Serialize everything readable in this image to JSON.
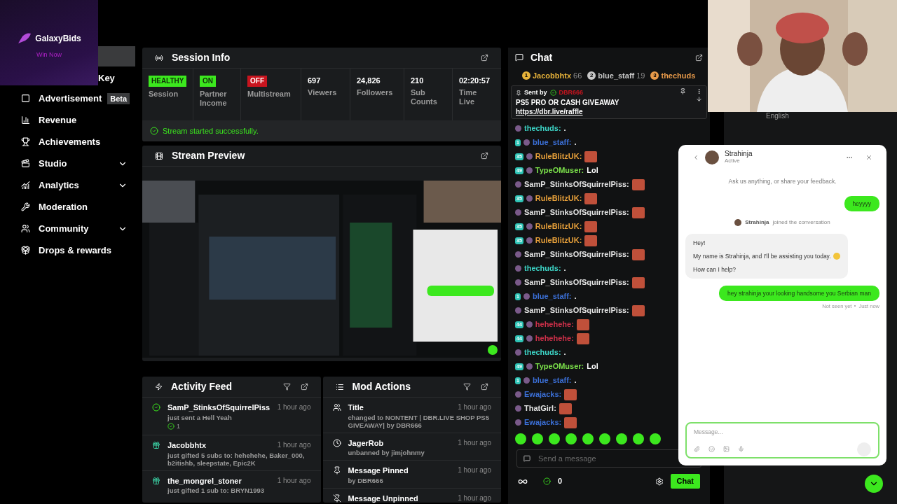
{
  "ad": {
    "brand": "GalaxyBids",
    "tagline": "Win Now"
  },
  "sidebar": {
    "items": [
      {
        "label": "Key",
        "kind": "partial"
      },
      {
        "label": "Advertisement",
        "badge": "Beta",
        "kind": "item",
        "expandable": false
      },
      {
        "label": "Revenue",
        "kind": "item",
        "expandable": false
      },
      {
        "label": "Achievements",
        "kind": "item",
        "expandable": false
      },
      {
        "label": "Studio",
        "kind": "item",
        "expandable": true
      },
      {
        "label": "Analytics",
        "kind": "item",
        "expandable": true
      },
      {
        "label": "Moderation",
        "kind": "item",
        "expandable": false
      },
      {
        "label": "Community",
        "kind": "item",
        "expandable": true
      },
      {
        "label": "Drops & rewards",
        "kind": "item",
        "expandable": false
      }
    ]
  },
  "session_info": {
    "title": "Session Info",
    "stats": [
      {
        "kind": "badge",
        "value": "HEALTHY",
        "label": "Session",
        "color": "#3ce81e"
      },
      {
        "kind": "badge",
        "value": "ON",
        "label": "Partner Income",
        "color": "#3ce81e"
      },
      {
        "kind": "badge",
        "value": "OFF",
        "label": "Multistream",
        "color": "#c8141e"
      },
      {
        "kind": "stat",
        "value": "697",
        "label": "Viewers"
      },
      {
        "kind": "stat",
        "value": "24,826",
        "label": "Followers"
      },
      {
        "kind": "stat",
        "value": "210",
        "label": "Sub Counts"
      },
      {
        "kind": "stat",
        "value": "02:20:57",
        "label": "Time Live"
      }
    ],
    "notice": "Stream started successfully."
  },
  "stream_preview": {
    "title": "Stream Preview",
    "kind": "picture"
  },
  "activity_feed": {
    "title": "Activity Feed",
    "items": [
      {
        "kind": "kick",
        "user": "SamP_StinksOfSquirrelPiss",
        "time": "1 hour ago",
        "detail": "just sent a **Hell Yeah**",
        "amount": "1"
      },
      {
        "kind": "gift",
        "user": "Jacobbhtx",
        "time": "1 hour ago",
        "detail": "just gifted **5** subs to: **hehehehe, Baker_000, b2itishb, sleepstate, Epic2K**"
      },
      {
        "kind": "gift",
        "user": "the_mongrel_stoner",
        "time": "1 hour ago",
        "detail": "just gifted **1** sub to: **BRYN1993**"
      }
    ]
  },
  "mod_actions": {
    "title": "Mod Actions",
    "items": [
      {
        "kind": "title",
        "title": "Title",
        "time": "1 hour ago",
        "detail": "changed to **NONTENT | DBR.LIVE SHOP PS5 GIVEAWAY|** by **DBR666**"
      },
      {
        "kind": "unban",
        "title": "JagerRob",
        "time": "1 hour ago",
        "detail": "unbanned by **jimjohnmy**"
      },
      {
        "kind": "pin",
        "title": "Message Pinned",
        "time": "1 hour ago",
        "detail": "by **DBR666**"
      },
      {
        "kind": "unpin",
        "title": "Message Unpinned",
        "time": "1 hour ago"
      }
    ]
  },
  "chat": {
    "title": "Chat",
    "leaderboard": [
      {
        "rank": "1",
        "user": "Jacobbhtx",
        "count": "66",
        "color": "#e8b33a"
      },
      {
        "rank": "2",
        "user": "blue_staff",
        "count": "19",
        "color": "#c8c8c8"
      },
      {
        "rank": "3",
        "user": "thechuds",
        "color": "#e89a4a"
      }
    ],
    "pinned": {
      "label": "Sent by",
      "sender": "DBR666",
      "text": "PS5 PRO OR CASH GIVEAWAY",
      "link": "https://dbr.live/raffle"
    },
    "messages": [
      {
        "user": "thechuds:",
        "text": ".",
        "color": "#3dd6c8",
        "emote": false
      },
      {
        "user": "blue_staff:",
        "text": ".",
        "color": "#3b6fd6",
        "badge": "1",
        "emote": false
      },
      {
        "user": "RuleBlitzUK:",
        "color": "#e8a03a",
        "badge": "35",
        "emote": true
      },
      {
        "user": "TypeOMuser:",
        "text": "Lol",
        "color": "#7be04a",
        "badge": "49",
        "emote": false
      },
      {
        "user": "SamP_StinksOfSquirrelPiss:",
        "color": "#e5e5e5",
        "emote": true
      },
      {
        "user": "RuleBlitzUK:",
        "color": "#e8a03a",
        "badge": "35",
        "emote": true
      },
      {
        "user": "SamP_StinksOfSquirrelPiss:",
        "color": "#e5e5e5",
        "emote": true
      },
      {
        "user": "RuleBlitzUK:",
        "color": "#e8a03a",
        "badge": "35",
        "emote": true
      },
      {
        "user": "RuleBlitzUK:",
        "color": "#e8a03a",
        "badge": "35",
        "emote": true
      },
      {
        "user": "SamP_StinksOfSquirrelPiss:",
        "color": "#e5e5e5",
        "emote": true
      },
      {
        "user": "thechuds:",
        "text": ".",
        "color": "#3dd6c8",
        "emote": false
      },
      {
        "user": "SamP_StinksOfSquirrelPiss:",
        "color": "#e5e5e5",
        "emote": true
      },
      {
        "user": "blue_staff:",
        "text": ".",
        "color": "#3b6fd6",
        "badge": "1",
        "emote": false
      },
      {
        "user": "SamP_StinksOfSquirrelPiss:",
        "color": "#e5e5e5",
        "emote": true
      },
      {
        "user": "hehehehe:",
        "color": "#d0304a",
        "badge": "44",
        "emote": true
      },
      {
        "user": "hehehehe:",
        "color": "#d0304a",
        "badge": "44",
        "emote": true
      },
      {
        "user": "thechuds:",
        "text": ".",
        "color": "#3dd6c8",
        "emote": false
      },
      {
        "user": "TypeOMuser:",
        "text": "Lol",
        "color": "#7be04a",
        "badge": "49",
        "emote": false
      },
      {
        "user": "blue_staff:",
        "text": ".",
        "color": "#3b6fd6",
        "badge": "1",
        "emote": false
      },
      {
        "user": "Ewajacks:",
        "color": "#3b6fd6",
        "emote": true
      },
      {
        "user": "ThatGirl:",
        "color": "#e5e5e5",
        "emote": true
      },
      {
        "user": "Ewajacks:",
        "color": "#3b6fd6",
        "emote": true
      }
    ],
    "input": {
      "placeholder": "Send a message"
    },
    "points": "0",
    "send": "Chat"
  },
  "background": {
    "language": "English"
  },
  "support": {
    "agent": "Strahinja",
    "status": "Active",
    "intro": "Ask us anything, or share your feedback.",
    "messages": [
      {
        "kind": "user",
        "text": "heyyyy"
      },
      {
        "kind": "system",
        "name": "Strahinja",
        "text": "joined the conversation"
      },
      {
        "kind": "agent",
        "paragraphs": [
          "Hey!",
          "My name is Strahinja, and I'll be assisting you today.",
          "How can I help?"
        ]
      },
      {
        "kind": "user",
        "text": "hey strahinja your looking handsome you Serbian man"
      }
    ],
    "receipt": {
      "seen": "Not seen yet",
      "time": "Just now"
    },
    "input": {
      "placeholder": "Message..."
    }
  }
}
